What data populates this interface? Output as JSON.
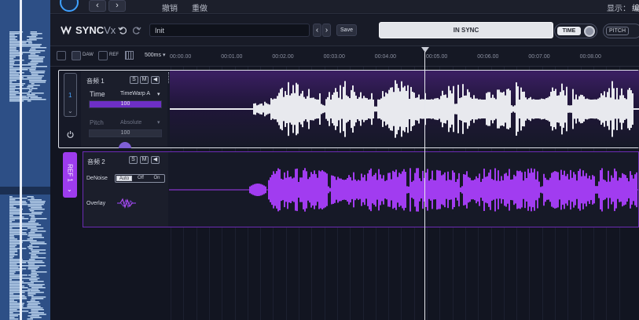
{
  "host": {
    "top_right_label": "显示：",
    "top_right_value": "编"
  },
  "topbar": {
    "back_glyph": "‹",
    "forward_glyph": "›",
    "undo_label": "撤销",
    "redo_label": "重做"
  },
  "header": {
    "brand_prefix": "SYNC",
    "brand_suffix": "Vx",
    "preset_name": "Init",
    "save_label": "Save",
    "sync_status": "IN SYNC",
    "time_label": "TIME",
    "pitch_label": "PITCH"
  },
  "ruler": {
    "daw_label": "DAW",
    "ref_label": "REF",
    "zoom_value": "500ms",
    "ticks": [
      "00:00.00",
      "00:01.00",
      "00:02.00",
      "00:03.00",
      "00:04.00",
      "00:05.00",
      "00:06.00",
      "00:07.00",
      "00:08.00"
    ]
  },
  "track1": {
    "lane_number": "1",
    "name": "音频 1",
    "solo": "S",
    "mute": "M",
    "time_label": "Time",
    "time_mode": "TimeWarp A",
    "time_amount": "100",
    "time_percent": 100,
    "pitch_label": "Pitch",
    "pitch_mode": "Absolute",
    "pitch_amount": "100",
    "pitch_percent": 100
  },
  "track2": {
    "tab_label": "REF 1",
    "name": "音频 2",
    "solo": "S",
    "mute": "M",
    "denoise_label": "DeNoise",
    "denoise_options": [
      "Auto",
      "Off",
      "On"
    ],
    "denoise_selected": "Auto",
    "overlay_label": "Overlay"
  },
  "colors": {
    "accent_purple": "#8f3fe6",
    "accent_blue": "#3ea0ff",
    "waveform_white": "#e8e9ee",
    "waveform_purple": "#a13cf0"
  }
}
